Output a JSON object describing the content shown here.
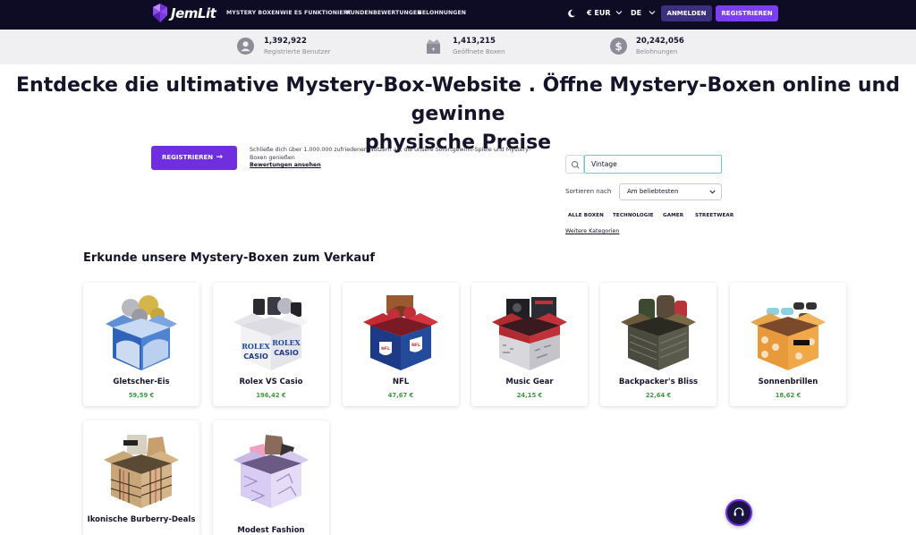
{
  "brand": {
    "name": "JemLit"
  },
  "nav": {
    "links": [
      "MYSTERY BOXEN",
      "WIE ES FUNKTIONIERT",
      "KUNDENBEWERTUNGEN",
      "BELOHNUNGEN"
    ],
    "currency": "€ EUR",
    "language": "DE",
    "login_label": "ANMELDEN",
    "register_label": "REGISTRIEREN"
  },
  "stats": [
    {
      "value": "1,392,922",
      "label": "Registrierte Benutzer",
      "icon": "user-icon"
    },
    {
      "value": "1,413,215",
      "label": "Geöffnete Boxen",
      "icon": "open-box-icon"
    },
    {
      "value": "20,242,056",
      "label": "Belohnungen",
      "icon": "dollar-icon"
    }
  ],
  "hero": {
    "title_bold": "Entdecke die ultimative Mystery-Box-Website",
    "title_rest_1": " . Öffne Mystery-Boxen online und gewinne",
    "title_rest_2": "physische Preise",
    "register_label": "REGISTRIEREN",
    "description": "Schließe dich über 1.000.000 zufriedenen Nutzern an, die unsere Sofortgewinn-Spiele und Mystery-Boxen genießen",
    "reviews_link": "Bewertungen ansehen"
  },
  "filters": {
    "search_value": "Vintage",
    "sort_label": "Sortieren nach",
    "sort_value": "Am beliebtesten",
    "categories": [
      "ALLE BOXEN",
      "TECHNOLOGIE",
      "GAMER",
      "STREETWEAR"
    ],
    "more_categories": "Weitere Kategorien"
  },
  "section_title": "Erkunde unsere Mystery-Boxen zum Verkauf",
  "boxes": [
    {
      "name": "Gletscher-Eis",
      "price": "59,59 €"
    },
    {
      "name": "Rolex VS Casio",
      "price": "196,42 €",
      "box_text_1": "ROLEX",
      "box_text_2": "CASIO"
    },
    {
      "name": "NFL",
      "price": "47,67 €",
      "box_text_1": "NFL"
    },
    {
      "name": "Music Gear",
      "price": "24,15 €"
    },
    {
      "name": "Backpacker's Bliss",
      "price": "22,64 €"
    },
    {
      "name": "Sonnenbrillen",
      "price": "18,62 €"
    },
    {
      "name": "Ikonische Burberry-Deals",
      "price": ""
    },
    {
      "name": "Modest Fashion",
      "price": ""
    }
  ],
  "colors": {
    "nav_bg": "#0e0c25",
    "accent": "#6f2fe0",
    "price_green": "#3b9a3f"
  }
}
